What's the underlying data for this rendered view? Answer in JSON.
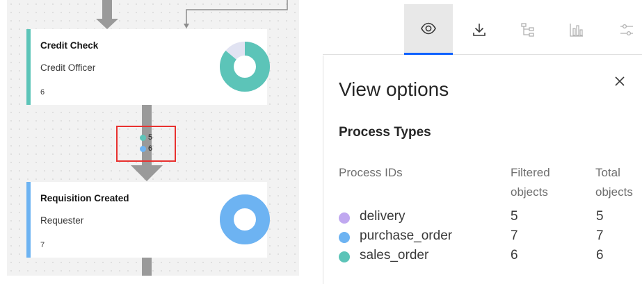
{
  "colors": {
    "teal": "#5cc4b8",
    "blue": "#6db3f2",
    "purple": "#c0a8f0",
    "teal_light": "#e1e3f2",
    "highlight_box": "#e8312f",
    "active_tab": "#0f62fe"
  },
  "flow": {
    "cards": [
      {
        "title": "Credit Check",
        "role": "Credit Officer",
        "count": "6",
        "stripe_color": "#5cc4b8",
        "donut_color": "#5cc4b8",
        "donut_fraction": 0.86
      },
      {
        "title": "Requisition Created",
        "role": "Requester",
        "count": "7",
        "stripe_color": "#6db3f2",
        "donut_color": "#6db3f2",
        "donut_fraction": 1.0
      }
    ],
    "edge_counts": [
      {
        "value": "5",
        "color": "#5cc4b8"
      },
      {
        "value": "6",
        "color": "#6db3f2"
      }
    ]
  },
  "toolbar": {
    "items": [
      {
        "icon": "eye-icon",
        "active": true
      },
      {
        "icon": "download-icon",
        "active": false
      },
      {
        "icon": "process-tree-icon",
        "active": false
      },
      {
        "icon": "bar-chart-icon",
        "active": false
      },
      {
        "icon": "filter-settings-icon",
        "active": false
      }
    ]
  },
  "panel": {
    "title": "View options",
    "close_icon": "close-icon",
    "section_title": "Process Types",
    "columns": {
      "process_ids": "Process IDs",
      "filtered": [
        "Filtered",
        "objects"
      ],
      "total": [
        "Total",
        "objects"
      ]
    },
    "rows": [
      {
        "id": "delivery",
        "filtered": "5",
        "total": "5",
        "color": "#c0a8f0"
      },
      {
        "id": "purchase_order",
        "filtered": "7",
        "total": "7",
        "color": "#6db3f2"
      },
      {
        "id": "sales_order",
        "filtered": "6",
        "total": "6",
        "color": "#5cc4b8"
      }
    ]
  }
}
